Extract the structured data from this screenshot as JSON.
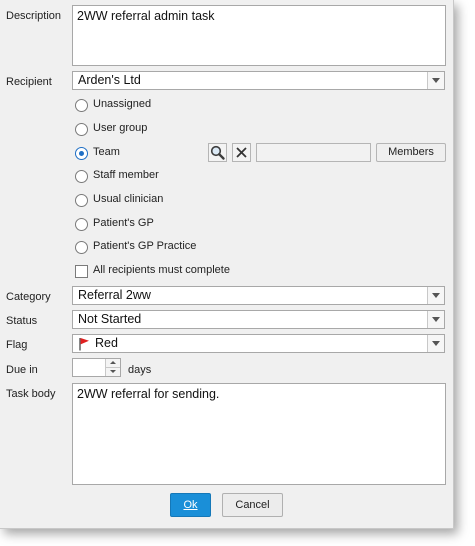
{
  "description": {
    "label": "Description",
    "value": "2WW referral admin task"
  },
  "recipient": {
    "label": "Recipient",
    "value": "Arden's Ltd",
    "options": [
      {
        "label": "Unassigned",
        "selected": false
      },
      {
        "label": "User group",
        "selected": false
      },
      {
        "label": "Team",
        "selected": true
      },
      {
        "label": "Staff member",
        "selected": false
      },
      {
        "label": "Usual clinician",
        "selected": false
      },
      {
        "label": "Patient's GP",
        "selected": false
      },
      {
        "label": "Patient's GP Practice",
        "selected": false
      }
    ],
    "team_field_value": "",
    "members_label": "Members",
    "all_must_complete_label": "All recipients must complete",
    "all_must_complete_checked": false
  },
  "category": {
    "label": "Category",
    "value": "Referral 2ww"
  },
  "status": {
    "label": "Status",
    "value": "Not Started"
  },
  "flag": {
    "label": "Flag",
    "value": "Red",
    "color": "#e02020"
  },
  "due_in": {
    "label": "Due in",
    "value": "",
    "unit": "days"
  },
  "task_body": {
    "label": "Task body",
    "value": "2WW referral for sending."
  },
  "buttons": {
    "ok_label": "Ok",
    "cancel_label": "Cancel"
  },
  "colors": {
    "ok_button": "#1a8fd8",
    "radio_selected": "#1f6fc5"
  }
}
